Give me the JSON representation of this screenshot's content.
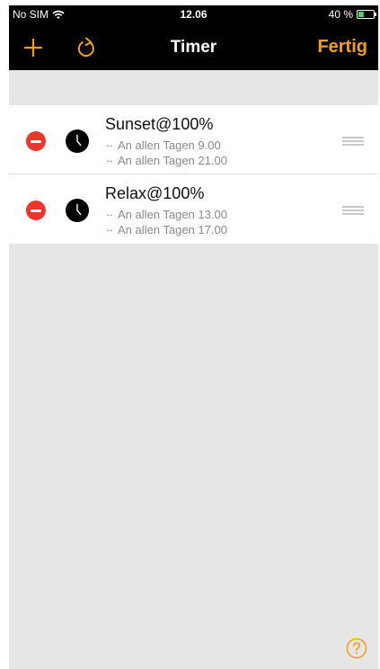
{
  "status_bar": {
    "carrier": "No SIM",
    "time": "12.06",
    "battery_text": "40 %",
    "battery_level": 0.4
  },
  "nav": {
    "title": "Timer",
    "done_label": "Fertig",
    "add_icon": "plus-icon",
    "refresh_icon": "refresh-icon"
  },
  "timers": [
    {
      "title": "Sunset@100%",
      "on_schedule": "An allen Tagen 9.00",
      "off_schedule": "An allen Tagen 21.00"
    },
    {
      "title": "Relax@100%",
      "on_schedule": "An allen Tagen 13.00",
      "off_schedule": "An allen Tagen 17.00"
    }
  ],
  "colors": {
    "accent": "#f0a020",
    "delete": "#f0352d",
    "background": "#e6e6e6"
  },
  "help_icon": "help-icon"
}
